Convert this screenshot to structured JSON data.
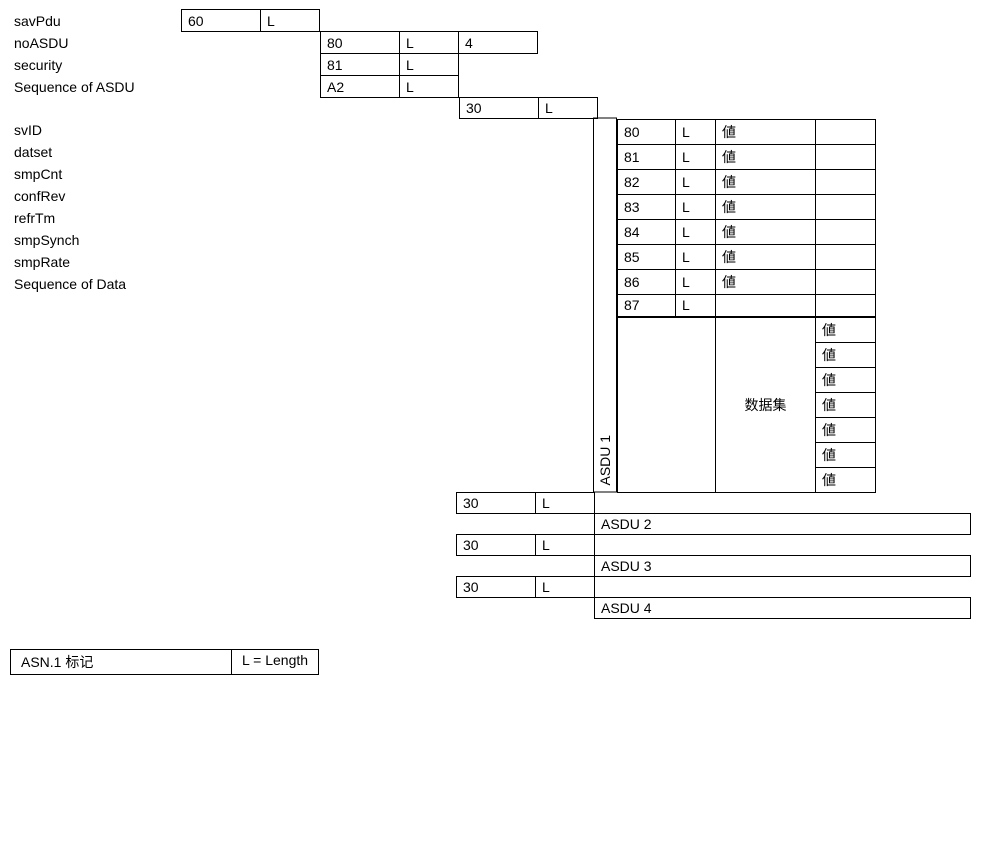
{
  "labels": {
    "savPdu": "savPdu",
    "noASDU": "noASDU",
    "security": "security",
    "sequenceOfASDU": "Sequence of ASDU",
    "svID": "svID",
    "datset": "datset",
    "smpCnt": "smpCnt",
    "confRev": "confRev",
    "refrTm": "refrTm",
    "smpSynch": "smpSynch",
    "smpRate": "smpRate",
    "sequenceOfData": "Sequence of Data"
  },
  "savPdu": {
    "tag": "60",
    "len": "L"
  },
  "noASDU": {
    "tag": "80",
    "len": "L",
    "val": "4"
  },
  "security": {
    "tag": "81",
    "len": "L"
  },
  "sequenceOfASDU": {
    "tag": "A2",
    "len": "L"
  },
  "asduHeader": {
    "tag": "30",
    "len": "L"
  },
  "asdu1": {
    "label": "ASDU 1",
    "rows": [
      {
        "tag": "80",
        "len": "L",
        "val": "値",
        "extra": ""
      },
      {
        "tag": "81",
        "len": "L",
        "val": "値",
        "extra": ""
      },
      {
        "tag": "82",
        "len": "L",
        "val": "値",
        "extra": ""
      },
      {
        "tag": "83",
        "len": "L",
        "val": "値",
        "extra": ""
      },
      {
        "tag": "84",
        "len": "L",
        "val": "値",
        "extra": ""
      },
      {
        "tag": "85",
        "len": "L",
        "val": "値",
        "extra": ""
      },
      {
        "tag": "86",
        "len": "L",
        "val": "値",
        "extra": ""
      },
      {
        "tag": "87",
        "len": "L",
        "val": "",
        "extra": ""
      }
    ],
    "datasetLabel": "数据集",
    "datasetValues": [
      "値",
      "値",
      "値",
      "値",
      "値",
      "値",
      "値"
    ]
  },
  "otherAsdus": [
    {
      "tag": "30",
      "len": "L",
      "label": "ASDU 2"
    },
    {
      "tag": "30",
      "len": "L",
      "label": "ASDU 3"
    },
    {
      "tag": "30",
      "len": "L",
      "label": "ASDU 4"
    }
  ],
  "legend": {
    "asn1": "ASN.1 标记",
    "length": "L = Length"
  }
}
